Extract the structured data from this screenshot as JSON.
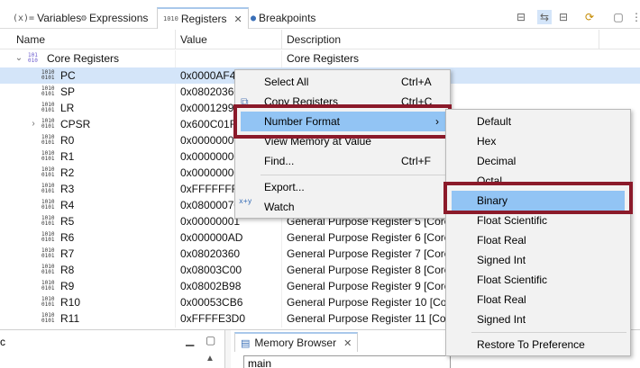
{
  "tabs": [
    {
      "icon": "(x)=",
      "label": "Variables"
    },
    {
      "icon": "⚙",
      "label": "Expressions"
    },
    {
      "icon": "1010",
      "label": "Registers"
    },
    {
      "icon": "●",
      "label": "Breakpoints"
    }
  ],
  "columns": {
    "name": "Name",
    "value": "Value",
    "description": "Description"
  },
  "rows": [
    {
      "name": "Core Registers",
      "value": "",
      "description": "Core Registers"
    },
    {
      "name": "PC",
      "value": "0x0000AF48",
      "description": ""
    },
    {
      "name": "SP",
      "value": "0x08020360",
      "description": ""
    },
    {
      "name": "LR",
      "value": "0x00012999",
      "description": ""
    },
    {
      "name": "CPSR",
      "value": "0x600C01FF",
      "description": ""
    },
    {
      "name": "R0",
      "value": "0x00000000",
      "description": ""
    },
    {
      "name": "R1",
      "value": "0x00000000",
      "description": ""
    },
    {
      "name": "R2",
      "value": "0x00000000",
      "description": ""
    },
    {
      "name": "R3",
      "value": "0xFFFFFFF1",
      "description": ""
    },
    {
      "name": "R4",
      "value": "0x08000070",
      "description": ""
    },
    {
      "name": "R5",
      "value": "0x00000001",
      "description": "General Purpose Register 5 [Core]"
    },
    {
      "name": "R6",
      "value": "0x000000AD",
      "description": "General Purpose Register 6 [Core]"
    },
    {
      "name": "R7",
      "value": "0x08020360",
      "description": "General Purpose Register 7 [Core]"
    },
    {
      "name": "R8",
      "value": "0x08003C00",
      "description": "General Purpose Register 8 [Core]"
    },
    {
      "name": "R9",
      "value": "0x08002B98",
      "description": "General Purpose Register 9 [Core]"
    },
    {
      "name": "R10",
      "value": "0x00053CB6",
      "description": "General Purpose Register 10 [Core]"
    },
    {
      "name": "R11",
      "value": "0xFFFFE3D0",
      "description": "General Purpose Register 11 [Core]"
    }
  ],
  "context_menu": {
    "select_all": {
      "label": "Select All",
      "shortcut": "Ctrl+A"
    },
    "copy_registers": {
      "label": "Copy Registers",
      "shortcut": "Ctrl+C"
    },
    "number_format": {
      "label": "Number Format"
    },
    "view_memory": {
      "label": "View Memory at Value"
    },
    "find": {
      "label": "Find...",
      "shortcut": "Ctrl+F"
    },
    "export": {
      "label": "Export..."
    },
    "watch": {
      "label": "Watch",
      "icon": "x+y"
    }
  },
  "submenu": [
    "Default",
    "Hex",
    "Decimal",
    "Octal",
    "Binary",
    "Float Scientific",
    "Float Real",
    "Signed Int",
    "Float Scientific",
    "Float Real",
    "Signed Int",
    "Restore To Preference"
  ],
  "bottom": {
    "left_label": "c",
    "memory_browser_tab": "Memory Browser",
    "memory_input_value": "main"
  },
  "colors": {
    "highlight": "#92c4f4",
    "selection": "#d4e5f9",
    "annotation": "#8b1a2a"
  }
}
